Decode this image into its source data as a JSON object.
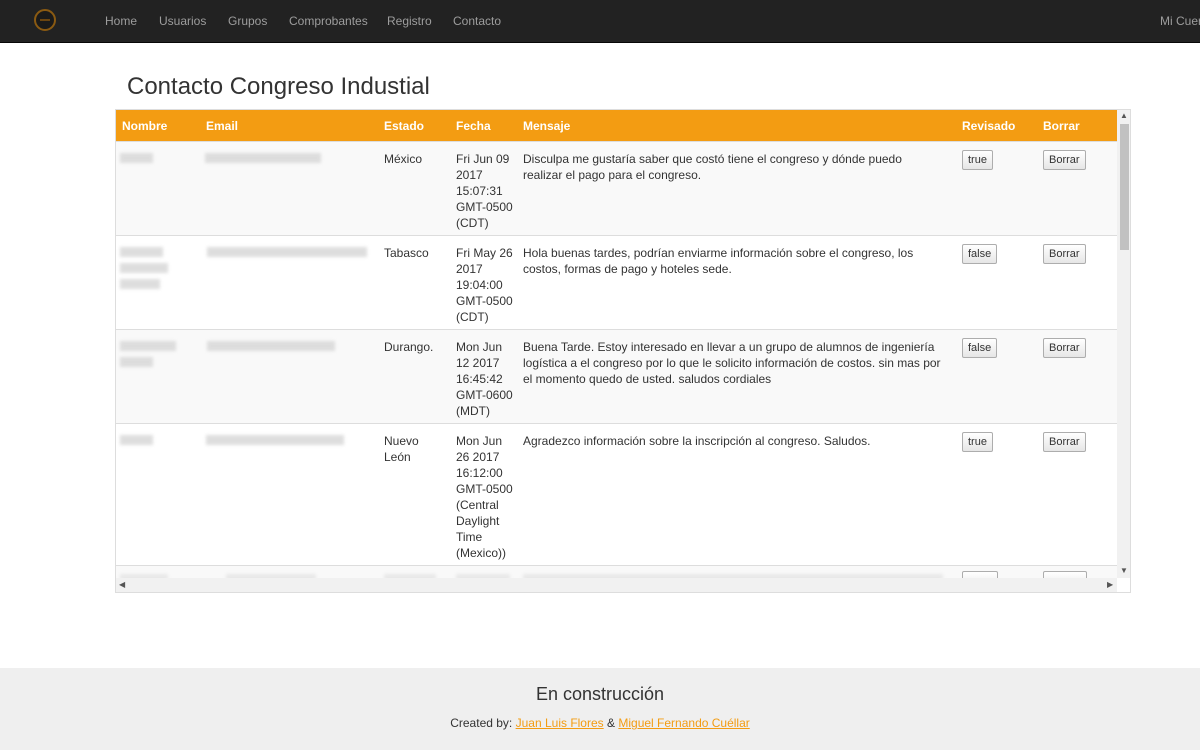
{
  "navbar": {
    "logo_icon": "conference-logo-icon",
    "links": [
      "Home",
      "Usuarios",
      "Grupos",
      "Comprobantes",
      "Registro",
      "Contacto"
    ],
    "right_link": "Mi Cuer"
  },
  "page": {
    "title": "Contacto Congreso Industial"
  },
  "table": {
    "header_color": "#f39c12",
    "headers": [
      "Nombre",
      "Email",
      "Estado",
      "Fecha",
      "Mensaje",
      "Revisado",
      "Borrar"
    ],
    "rows": [
      {
        "estado": "México",
        "fecha": "Fri Jun 09 2017 15:07:31 GMT-0500 (CDT)",
        "mensaje": "Disculpa me gustaría saber que costó tiene el congreso y dónde puedo realizar el pago para el congreso.",
        "revisado": "true",
        "borrar": "Borrar"
      },
      {
        "estado": "Tabasco",
        "fecha": "Fri May 26 2017 19:04:00 GMT-0500 (CDT)",
        "mensaje": "Hola buenas tardes, podrían enviarme información sobre el congreso, los costos, formas de pago y hoteles sede.",
        "revisado": "false",
        "borrar": "Borrar"
      },
      {
        "estado": "Durango.",
        "fecha": "Mon Jun 12 2017 16:45:42 GMT-0600 (MDT)",
        "mensaje": "Buena Tarde. Estoy interesado en llevar a un grupo de alumnos de ingeniería logística a el congreso por lo que le solicito información de costos. sin mas por el momento quedo de usted. saludos cordiales",
        "revisado": "false",
        "borrar": "Borrar"
      },
      {
        "estado": "Nuevo León",
        "fecha": "Mon Jun 26 2017 16:12:00 GMT-0500 (Central Daylight Time (Mexico))",
        "mensaje": "Agradezco información sobre la inscripción al congreso. Saludos.",
        "revisado": "true",
        "borrar": "Borrar"
      }
    ]
  },
  "footer": {
    "title": "En construcción",
    "created_by": "Created by:",
    "author1": "Juan Luis Flores",
    "separator": "&",
    "author2": "Miguel Fernando Cuéllar"
  }
}
